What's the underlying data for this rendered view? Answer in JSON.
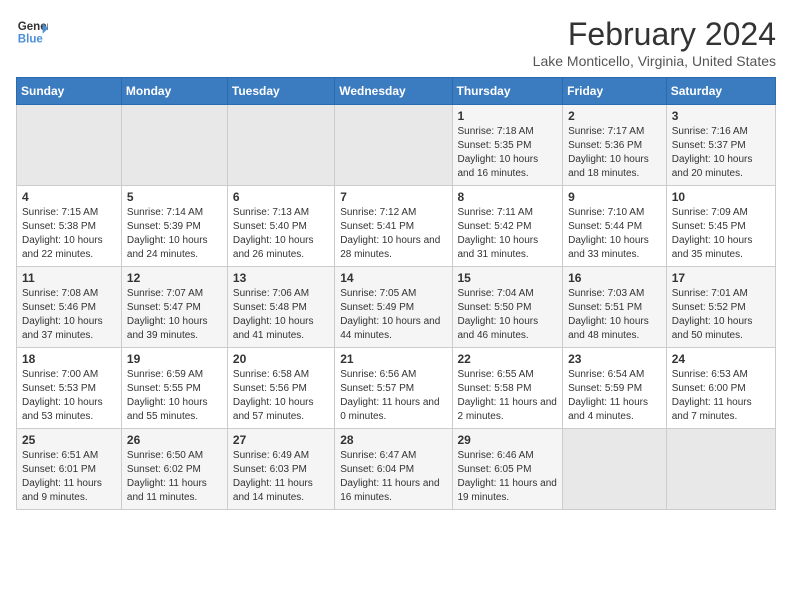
{
  "header": {
    "logo_line1": "General",
    "logo_line2": "Blue",
    "main_title": "February 2024",
    "subtitle": "Lake Monticello, Virginia, United States"
  },
  "calendar": {
    "days_of_week": [
      "Sunday",
      "Monday",
      "Tuesday",
      "Wednesday",
      "Thursday",
      "Friday",
      "Saturday"
    ],
    "weeks": [
      [
        {
          "day": "",
          "empty": true
        },
        {
          "day": "",
          "empty": true
        },
        {
          "day": "",
          "empty": true
        },
        {
          "day": "",
          "empty": true
        },
        {
          "day": "1",
          "rise": "7:18 AM",
          "set": "5:35 PM",
          "daylight": "10 hours and 16 minutes."
        },
        {
          "day": "2",
          "rise": "7:17 AM",
          "set": "5:36 PM",
          "daylight": "10 hours and 18 minutes."
        },
        {
          "day": "3",
          "rise": "7:16 AM",
          "set": "5:37 PM",
          "daylight": "10 hours and 20 minutes."
        }
      ],
      [
        {
          "day": "4",
          "rise": "7:15 AM",
          "set": "5:38 PM",
          "daylight": "10 hours and 22 minutes."
        },
        {
          "day": "5",
          "rise": "7:14 AM",
          "set": "5:39 PM",
          "daylight": "10 hours and 24 minutes."
        },
        {
          "day": "6",
          "rise": "7:13 AM",
          "set": "5:40 PM",
          "daylight": "10 hours and 26 minutes."
        },
        {
          "day": "7",
          "rise": "7:12 AM",
          "set": "5:41 PM",
          "daylight": "10 hours and 28 minutes."
        },
        {
          "day": "8",
          "rise": "7:11 AM",
          "set": "5:42 PM",
          "daylight": "10 hours and 31 minutes."
        },
        {
          "day": "9",
          "rise": "7:10 AM",
          "set": "5:44 PM",
          "daylight": "10 hours and 33 minutes."
        },
        {
          "day": "10",
          "rise": "7:09 AM",
          "set": "5:45 PM",
          "daylight": "10 hours and 35 minutes."
        }
      ],
      [
        {
          "day": "11",
          "rise": "7:08 AM",
          "set": "5:46 PM",
          "daylight": "10 hours and 37 minutes."
        },
        {
          "day": "12",
          "rise": "7:07 AM",
          "set": "5:47 PM",
          "daylight": "10 hours and 39 minutes."
        },
        {
          "day": "13",
          "rise": "7:06 AM",
          "set": "5:48 PM",
          "daylight": "10 hours and 41 minutes."
        },
        {
          "day": "14",
          "rise": "7:05 AM",
          "set": "5:49 PM",
          "daylight": "10 hours and 44 minutes."
        },
        {
          "day": "15",
          "rise": "7:04 AM",
          "set": "5:50 PM",
          "daylight": "10 hours and 46 minutes."
        },
        {
          "day": "16",
          "rise": "7:03 AM",
          "set": "5:51 PM",
          "daylight": "10 hours and 48 minutes."
        },
        {
          "day": "17",
          "rise": "7:01 AM",
          "set": "5:52 PM",
          "daylight": "10 hours and 50 minutes."
        }
      ],
      [
        {
          "day": "18",
          "rise": "7:00 AM",
          "set": "5:53 PM",
          "daylight": "10 hours and 53 minutes."
        },
        {
          "day": "19",
          "rise": "6:59 AM",
          "set": "5:55 PM",
          "daylight": "10 hours and 55 minutes."
        },
        {
          "day": "20",
          "rise": "6:58 AM",
          "set": "5:56 PM",
          "daylight": "10 hours and 57 minutes."
        },
        {
          "day": "21",
          "rise": "6:56 AM",
          "set": "5:57 PM",
          "daylight": "11 hours and 0 minutes."
        },
        {
          "day": "22",
          "rise": "6:55 AM",
          "set": "5:58 PM",
          "daylight": "11 hours and 2 minutes."
        },
        {
          "day": "23",
          "rise": "6:54 AM",
          "set": "5:59 PM",
          "daylight": "11 hours and 4 minutes."
        },
        {
          "day": "24",
          "rise": "6:53 AM",
          "set": "6:00 PM",
          "daylight": "11 hours and 7 minutes."
        }
      ],
      [
        {
          "day": "25",
          "rise": "6:51 AM",
          "set": "6:01 PM",
          "daylight": "11 hours and 9 minutes."
        },
        {
          "day": "26",
          "rise": "6:50 AM",
          "set": "6:02 PM",
          "daylight": "11 hours and 11 minutes."
        },
        {
          "day": "27",
          "rise": "6:49 AM",
          "set": "6:03 PM",
          "daylight": "11 hours and 14 minutes."
        },
        {
          "day": "28",
          "rise": "6:47 AM",
          "set": "6:04 PM",
          "daylight": "11 hours and 16 minutes."
        },
        {
          "day": "29",
          "rise": "6:46 AM",
          "set": "6:05 PM",
          "daylight": "11 hours and 19 minutes."
        },
        {
          "day": "",
          "empty": true
        },
        {
          "day": "",
          "empty": true
        }
      ]
    ]
  }
}
